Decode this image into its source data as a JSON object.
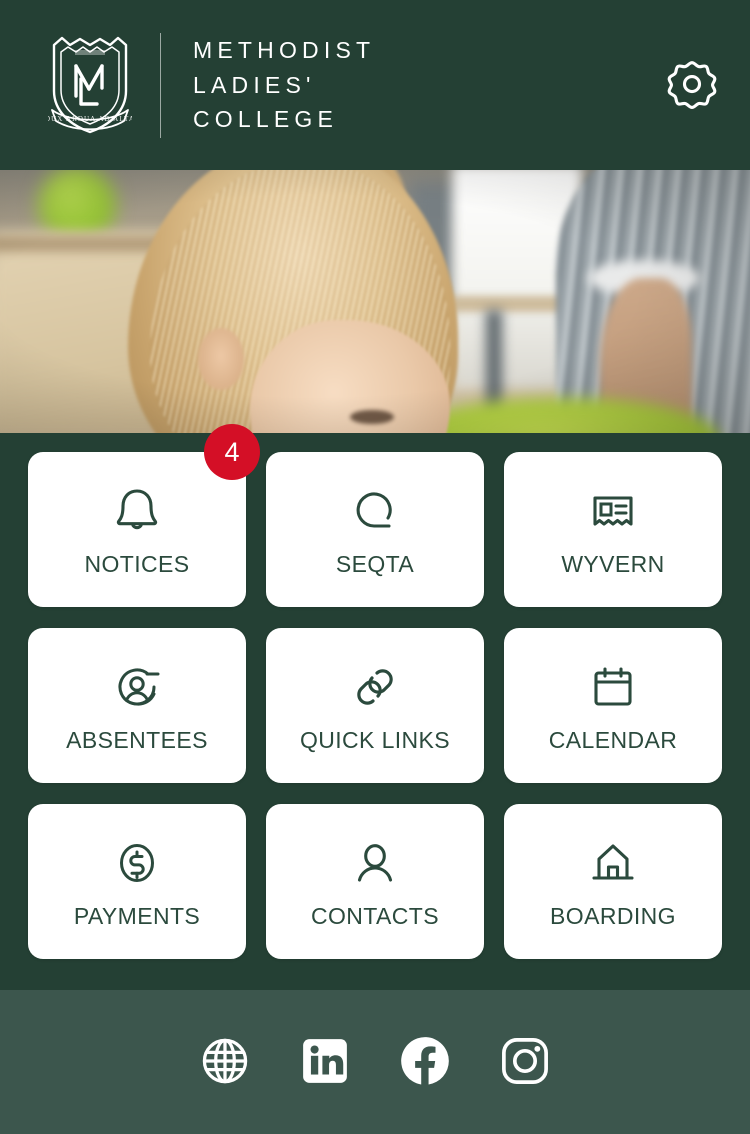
{
  "colors": {
    "brand_dark_green": "#244034",
    "footer_green": "#3c564d",
    "tile_bg": "#ffffff",
    "tile_text": "#2b4a3d",
    "badge_red": "#d40f26",
    "header_text": "#ffffff"
  },
  "header": {
    "crest_icon": "mlc-crest-icon",
    "crest_monogram": "MLC",
    "crest_motto": "DUX ARDUA AD ALTA",
    "brand_lines": [
      "METHODIST",
      "LADIES'",
      "COLLEGE"
    ],
    "settings_icon": "gear-icon",
    "settings_label": "Settings"
  },
  "hero": {
    "alt": "Young student smiling in a classroom"
  },
  "grid": {
    "tiles": [
      {
        "label": "NOTICES",
        "icon": "bell-icon",
        "badge": "4"
      },
      {
        "label": "SEQTA",
        "icon": "seqta-q-icon",
        "badge": null
      },
      {
        "label": "WYVERN",
        "icon": "newsletter-icon",
        "badge": null
      },
      {
        "label": "ABSENTEES",
        "icon": "user-minus-icon",
        "badge": null
      },
      {
        "label": "QUICK LINKS",
        "icon": "link-icon",
        "badge": null
      },
      {
        "label": "CALENDAR",
        "icon": "calendar-icon",
        "badge": null
      },
      {
        "label": "PAYMENTS",
        "icon": "dollar-circle-icon",
        "badge": null
      },
      {
        "label": "CONTACTS",
        "icon": "person-icon",
        "badge": null
      },
      {
        "label": "BOARDING",
        "icon": "house-icon",
        "badge": null
      }
    ]
  },
  "footer": {
    "socials": [
      {
        "name": "website",
        "icon": "globe-icon",
        "label": "Website"
      },
      {
        "name": "linkedin",
        "icon": "linkedin-icon",
        "label": "LinkedIn"
      },
      {
        "name": "facebook",
        "icon": "facebook-icon",
        "label": "Facebook"
      },
      {
        "name": "instagram",
        "icon": "instagram-icon",
        "label": "Instagram"
      }
    ]
  }
}
